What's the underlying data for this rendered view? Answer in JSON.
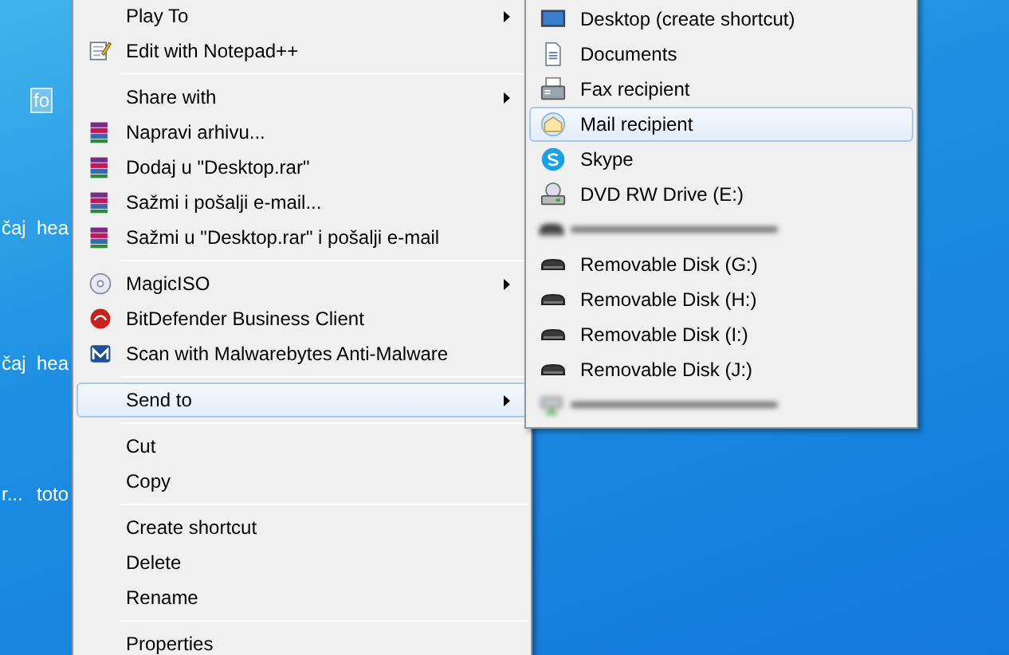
{
  "desktop_icons": [
    {
      "label": "fo",
      "selected": true
    },
    {
      "label": "čaj",
      "selected": false
    },
    {
      "label": "hea",
      "selected": false
    },
    {
      "label": "čaj",
      "selected": false
    },
    {
      "label": "hea",
      "selected": false
    },
    {
      "label": "r...",
      "selected": false
    },
    {
      "label": "toto",
      "selected": false
    }
  ],
  "context_menu": {
    "items": [
      {
        "kind": "item",
        "label": "Play To",
        "submenu": true,
        "selected": false
      },
      {
        "kind": "item",
        "label": "Edit with Notepad++",
        "submenu": false,
        "selected": false
      },
      {
        "kind": "separator"
      },
      {
        "kind": "item",
        "label": "Share with",
        "submenu": true,
        "selected": false
      },
      {
        "kind": "item",
        "label": "Napravi arhivu...",
        "submenu": false,
        "selected": false
      },
      {
        "kind": "item",
        "label": "Dodaj u \"Desktop.rar\"",
        "submenu": false,
        "selected": false
      },
      {
        "kind": "item",
        "label": "Sažmi i pošalji e-mail...",
        "submenu": false,
        "selected": false
      },
      {
        "kind": "item",
        "label": "Sažmi u \"Desktop.rar\" i pošalji e-mail",
        "submenu": false,
        "selected": false
      },
      {
        "kind": "separator"
      },
      {
        "kind": "item",
        "label": "MagicISO",
        "submenu": true,
        "selected": false
      },
      {
        "kind": "item",
        "label": "BitDefender Business Client",
        "submenu": false,
        "selected": false
      },
      {
        "kind": "item",
        "label": "Scan with Malwarebytes Anti-Malware",
        "submenu": false,
        "selected": false
      },
      {
        "kind": "separator"
      },
      {
        "kind": "item",
        "label": "Send to",
        "submenu": true,
        "selected": true
      },
      {
        "kind": "separator"
      },
      {
        "kind": "item",
        "label": "Cut",
        "submenu": false,
        "selected": false
      },
      {
        "kind": "item",
        "label": "Copy",
        "submenu": false,
        "selected": false
      },
      {
        "kind": "separator"
      },
      {
        "kind": "item",
        "label": "Create shortcut",
        "submenu": false,
        "selected": false
      },
      {
        "kind": "item",
        "label": "Delete",
        "submenu": false,
        "selected": false
      },
      {
        "kind": "item",
        "label": "Rename",
        "submenu": false,
        "selected": false
      },
      {
        "kind": "separator"
      },
      {
        "kind": "item",
        "label": "Properties",
        "submenu": false,
        "selected": false
      }
    ]
  },
  "send_to_menu": {
    "items": [
      {
        "kind": "item",
        "label": "Desktop (create shortcut)",
        "selected": false
      },
      {
        "kind": "item",
        "label": "Documents",
        "selected": false
      },
      {
        "kind": "item",
        "label": "Fax recipient",
        "selected": false
      },
      {
        "kind": "item",
        "label": "Mail recipient",
        "selected": true
      },
      {
        "kind": "item",
        "label": "Skype",
        "selected": false
      },
      {
        "kind": "item",
        "label": "DVD RW Drive (E:)",
        "selected": false
      },
      {
        "kind": "blurred"
      },
      {
        "kind": "item",
        "label": "Removable Disk (G:)",
        "selected": false
      },
      {
        "kind": "item",
        "label": "Removable Disk (H:)",
        "selected": false
      },
      {
        "kind": "item",
        "label": "Removable Disk (I:)",
        "selected": false
      },
      {
        "kind": "item",
        "label": "Removable Disk (J:)",
        "selected": false
      },
      {
        "kind": "blurred"
      }
    ]
  }
}
